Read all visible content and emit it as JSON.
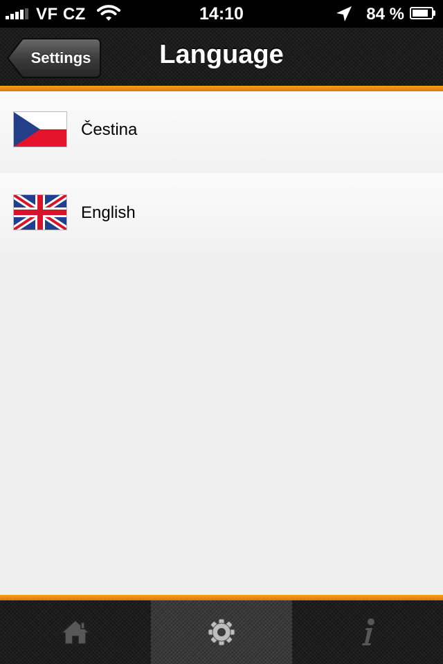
{
  "status_bar": {
    "carrier": "VF CZ",
    "time": "14:10",
    "battery_percent": "84 %",
    "battery_level": 0.84,
    "icons": [
      "signal-icon",
      "wifi-icon",
      "location-arrow-icon",
      "battery-icon"
    ]
  },
  "nav": {
    "back_label": "Settings",
    "title": "Language"
  },
  "languages": [
    {
      "label": "Čestina",
      "flag": "czech-flag-icon"
    },
    {
      "label": "English",
      "flag": "uk-flag-icon"
    }
  ],
  "tab_bar": {
    "tabs": [
      {
        "icon": "home-icon",
        "selected": false
      },
      {
        "icon": "gear-icon",
        "selected": true
      },
      {
        "icon": "info-icon",
        "selected": false
      }
    ]
  },
  "colors": {
    "accent_orange": "#f39c12",
    "bar_dark": "#1c1c1c",
    "list_background": "#efefef"
  }
}
